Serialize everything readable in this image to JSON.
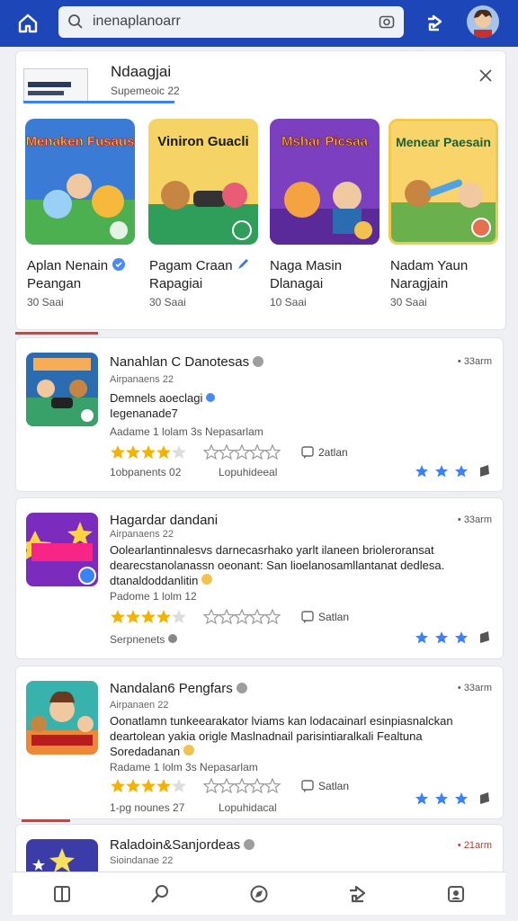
{
  "search": {
    "value": "inenaplanoarr"
  },
  "featured": {
    "title": "Ndaagjai",
    "subtitle": "Supemeoic 22",
    "games": [
      {
        "name_line1": "Aplan Nenain",
        "name_line2": "Peangan",
        "meta": "30 Saai",
        "tile_text": "Menaken Fusaus",
        "colors": [
          "#3a7bd5",
          "#f4a340"
        ]
      },
      {
        "name_line1": "Pagam Craan",
        "name_line2": "Rapagiai",
        "meta": "30 Saai",
        "tile_text": "Viniron Guacli",
        "colors": [
          "#2f9e5a",
          "#f6d365"
        ]
      },
      {
        "name_line1": "Naga Masin",
        "name_line2": "Dlanagai",
        "meta": "10 Saai",
        "tile_text": "Mshar Picsaa",
        "colors": [
          "#7b3fbf",
          "#e85d75"
        ]
      },
      {
        "name_line1": "Nadam Yaun",
        "name_line2": "Naragjain",
        "meta": "30 Saai",
        "tile_text": "Menear Paesain",
        "colors": [
          "#f2c14e",
          "#e76f51"
        ]
      }
    ]
  },
  "posts": [
    {
      "title": "Nanahlan C Danotesas",
      "subtitle": "Airpanaens 22",
      "time": "• 33arm",
      "text_line1": "Demnels aoeclagi",
      "text_line2": "Iegenanade7",
      "meta": "Aadame 1 lolam 3s Nepasarlam",
      "rating_label": "2atlan",
      "footer_left": "1obpanents 02",
      "footer_right": "Lopuhideeal",
      "thumb_colors": [
        "#2b6cb0",
        "#f6ad55"
      ]
    },
    {
      "title": "Hagardar dandani",
      "subtitle": "Airpanaens 22",
      "time": "• 33arm",
      "text_line1": "Oolearlantinnalesvs darnecasrhako yarlt ilaneen brioleroransat",
      "text_line2": "dearecstanolanassn oeonant: San lioelanosamllantanat dedlesa.",
      "text_line3": "dtanaldoddanlitin",
      "meta": "Padome 1 lolm 12",
      "rating_label": "Satlan",
      "footer_left": "Serpnenets",
      "footer_right": "",
      "thumb_colors": [
        "#7b2cbf",
        "#f72585"
      ]
    },
    {
      "title": "Nandalan6 Pengfars",
      "subtitle": "Airpanaen 22",
      "time": "• 33arm",
      "text_line1": "Oonatlamn tunkeearakator lviams kan lodacainarl esinpiasnalckan",
      "text_line2": "deartolean yakia origle Maslnadnail parisintiaralkali Fealtuna",
      "text_line3": "Soredadanan",
      "meta": "Radame 1 lolm 3s Nepasarlam",
      "rating_label": "Satlan",
      "footer_left": "1-pg nounes 27",
      "footer_right": "Lopuhidacal",
      "thumb_colors": [
        "#38b2ac",
        "#ed8936"
      ]
    },
    {
      "title": "Raladoin&Sanjordeas",
      "subtitle": "Sioindanae 22",
      "time": "• 21arm",
      "thumb_colors": [
        "#3c3ca8",
        "#f6e05e"
      ]
    }
  ]
}
